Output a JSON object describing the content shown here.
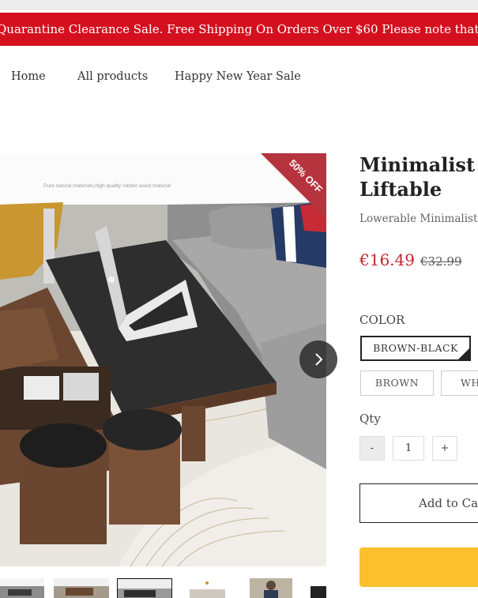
{
  "promo": {
    "text": "Quarantine Clearance Sale. Free Shipping On Orders Over $60 Please note that shipping delays"
  },
  "nav": {
    "items": [
      {
        "label": "Home"
      },
      {
        "label": "All products"
      },
      {
        "label": "Happy New Year Sale"
      }
    ]
  },
  "gallery": {
    "badge": "50% OFF",
    "image_caption": "Pure natural materials,high quality rubber wood material",
    "thumbnail_count": 6,
    "active_thumbnail": 3
  },
  "product": {
    "title_line1": "Minimalist R",
    "title_line2": "Liftable",
    "subtitle": "Lowerable Minimalist R",
    "price": "€16.49",
    "compare_price": "€32.99"
  },
  "options": {
    "color_label": "COLOR",
    "colors": [
      {
        "label": "BROWN-BLACK",
        "selected": true
      },
      {
        "label": "BROWN",
        "selected": false
      },
      {
        "label": "WH",
        "selected": false
      }
    ]
  },
  "quantity": {
    "label": "Qty",
    "minus": "-",
    "value": "1",
    "plus": "+"
  },
  "actions": {
    "add_to_cart": "Add to Car",
    "buy_now": ""
  },
  "colors": {
    "promo_bg": "#d4101f",
    "badge_bg": "#b5343d",
    "price": "#c4232e",
    "buy_button": "#fbc02d"
  }
}
